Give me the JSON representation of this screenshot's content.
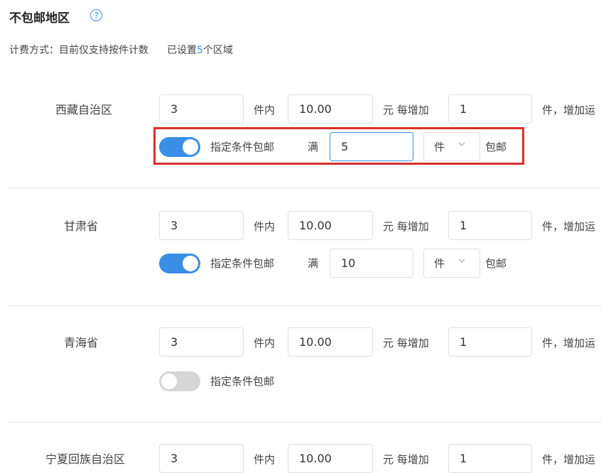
{
  "header": {
    "title": "不包邮地区",
    "help_icon": "?",
    "billing_label": "计费方式：",
    "billing_method": "目前仅支持按件计数",
    "set_prefix": "已设置",
    "set_count": "5",
    "set_suffix": "个区域"
  },
  "labels": {
    "within": "件内",
    "yuan_each": "元 每增加",
    "piece_increase": "件，增加运",
    "condition": "指定条件包邮",
    "full": "满",
    "free": "包邮"
  },
  "regions": [
    {
      "name": "西藏自治区",
      "first_count": "3",
      "first_fee": "10.00",
      "add_count": "1",
      "free_shipping_enabled": true,
      "threshold": "5",
      "threshold_unit": "件"
    },
    {
      "name": "甘肃省",
      "first_count": "3",
      "first_fee": "10.00",
      "add_count": "1",
      "free_shipping_enabled": true,
      "threshold": "10",
      "threshold_unit": "件"
    },
    {
      "name": "青海省",
      "first_count": "3",
      "first_fee": "10.00",
      "add_count": "1",
      "free_shipping_enabled": false
    },
    {
      "name": "宁夏回族自治区",
      "first_count": "3",
      "first_fee": "10.00",
      "add_count": "1"
    }
  ],
  "colors": {
    "accent": "#3a8ee6",
    "highlight": "#d9302c",
    "switch_off": "#d6d6d6"
  }
}
